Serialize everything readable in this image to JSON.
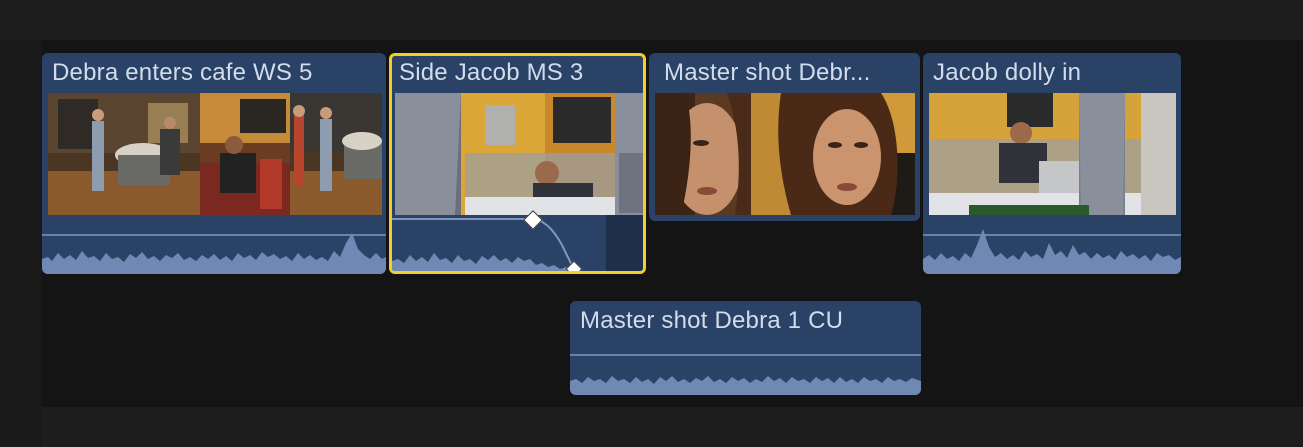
{
  "timeline": {
    "primary_clips": [
      {
        "id": "clip1",
        "title": "Debra enters cafe WS 5",
        "selected": false
      },
      {
        "id": "clip2",
        "title": "Side Jacob MS 3",
        "selected": true
      },
      {
        "id": "clip3",
        "title": "Master shot Debr...",
        "selected": false
      },
      {
        "id": "clip4",
        "title": "Jacob dolly in",
        "selected": false
      }
    ],
    "connected_clips": [
      {
        "id": "clip5",
        "title": "Master shot Debra 1 CU",
        "type": "audio"
      }
    ]
  },
  "colors": {
    "clip_body": "#2a4266",
    "waveform": "#6f89b4",
    "selection": "#f4cf2a",
    "background": "#141414"
  },
  "icons": [
    "keyframe-icon"
  ]
}
